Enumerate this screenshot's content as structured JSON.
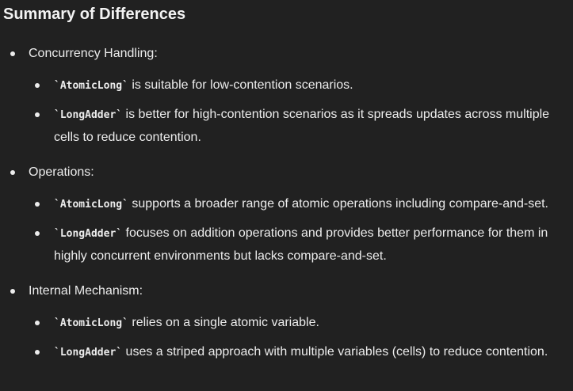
{
  "heading": "Summary of Differences",
  "sections": [
    {
      "term": "Concurrency Handling",
      "suffix": ":",
      "items": [
        {
          "code": "`AtomicLong`",
          "text": " is suitable for low-contention scenarios."
        },
        {
          "code": "`LongAdder`",
          "text": " is better for high-contention scenarios as it spreads updates across multiple cells to reduce contention."
        }
      ]
    },
    {
      "term": "Operations",
      "suffix": ":",
      "items": [
        {
          "code": "`AtomicLong`",
          "text": " supports a broader range of atomic operations including compare-and-set."
        },
        {
          "code": "`LongAdder`",
          "text": " focuses on addition operations and provides better performance for them in highly concurrent environments but lacks compare-and-set."
        }
      ]
    },
    {
      "term": "Internal Mechanism",
      "suffix": ":",
      "items": [
        {
          "code": "`AtomicLong`",
          "text": " relies on a single atomic variable."
        },
        {
          "code": "`LongAdder`",
          "text": " uses a striped approach with multiple variables (cells) to reduce contention."
        }
      ]
    }
  ]
}
